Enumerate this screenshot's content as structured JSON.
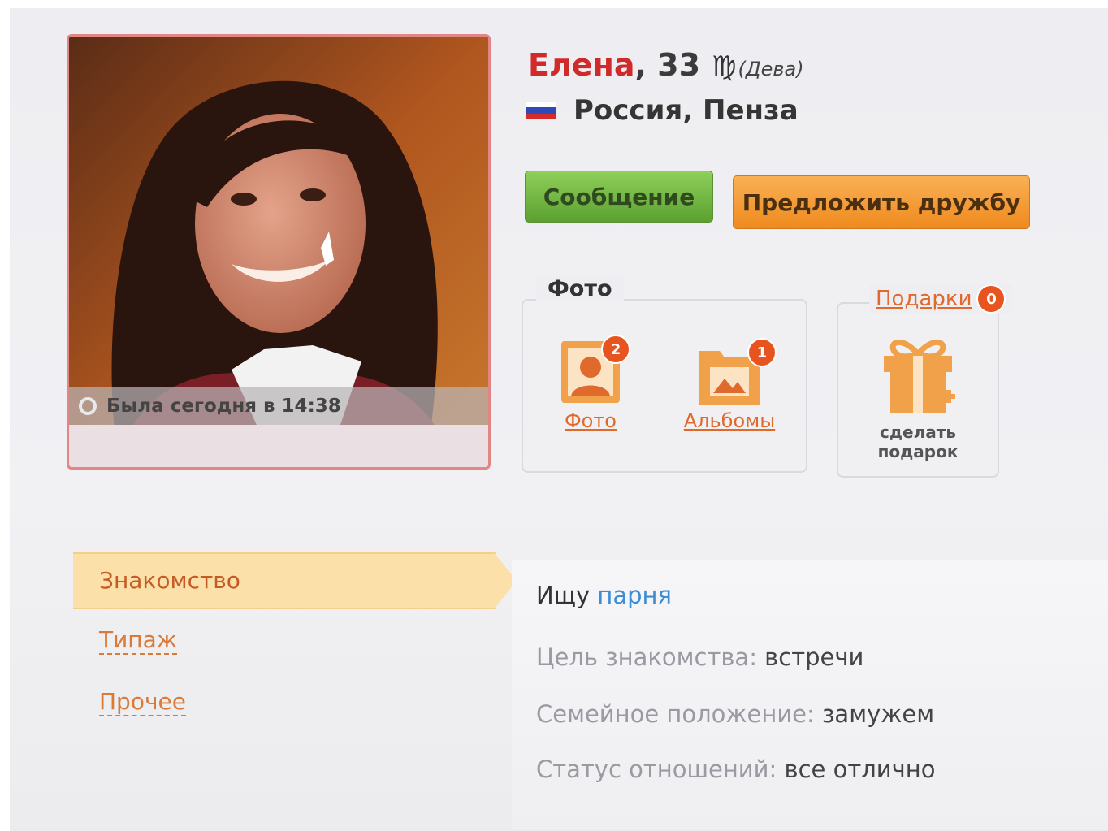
{
  "profile": {
    "name": "Елена",
    "age_text": ", 33",
    "zodiac_sign": "♍",
    "zodiac_text": "(Дева)",
    "location": "Россия, Пенза",
    "online_status": "Была сегодня в 14:38"
  },
  "actions": {
    "message_label": "Сообщение",
    "friend_label": "Предложить дружбу"
  },
  "photos_section": {
    "legend": "Фото",
    "photos_label": "Фото",
    "photos_count": "2",
    "albums_label": "Альбомы",
    "albums_count": "1"
  },
  "gifts_section": {
    "legend": "Подарки",
    "count": "0",
    "caption_line1": "сделать",
    "caption_line2": "подарок"
  },
  "tabs": {
    "active": "Знакомство",
    "type": "Типаж",
    "other": "Прочее"
  },
  "details": {
    "seek_prefix": "Ищу ",
    "seek_value": "парня",
    "goal_label": "Цель знакомства:",
    "goal_value": " встречи",
    "family_label": "Семейное положение:",
    "family_value": " замужем",
    "status_label": "Статус отношений:",
    "status_value": " все отлично"
  },
  "colors": {
    "name": "#d12a2a",
    "accent_orange": "#e0692c",
    "message_button": "#6fb53f",
    "friend_button": "#f29a30",
    "link_blue": "#3d8dd6"
  }
}
